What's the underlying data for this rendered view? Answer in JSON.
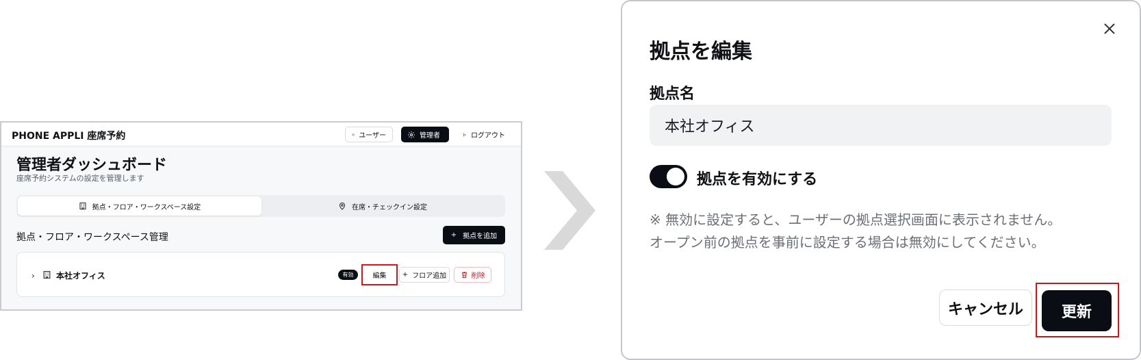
{
  "dashboard": {
    "app_title": "PHONE APPLI 座席予約",
    "header": {
      "user_label": "ユーザー",
      "admin_label": "管理者",
      "logout_label": "ログアウト"
    },
    "title": "管理者ダッシュボード",
    "subtitle": "座席予約システムの設定を管理します",
    "tabs": [
      {
        "label": "拠点・フロア・ワークスペース設定",
        "icon": "building-icon",
        "active": true
      },
      {
        "label": "在席・チェックイン設定",
        "icon": "map-pin-icon",
        "active": false
      }
    ],
    "section_title": "拠点・フロア・ワークスペース管理",
    "add_site_label": "拠点を追加",
    "site": {
      "name": "本社オフィス",
      "status_badge": "有効",
      "edit_label": "編集",
      "add_floor_label": "フロア追加",
      "delete_label": "削除"
    }
  },
  "modal": {
    "title": "拠点を編集",
    "field_label": "拠点名",
    "field_value": "本社オフィス",
    "toggle_on": true,
    "toggle_label": "拠点を有効にする",
    "note_line1": "※ 無効に設定すると、ユーザーの拠点選択画面に表示されません。",
    "note_line2": "オープン前の拠点を事前に設定する場合は無効にしてください。",
    "cancel_label": "キャンセル",
    "update_label": "更新"
  },
  "colors": {
    "primary": "#0b0d14",
    "highlight": "#d3121c",
    "arrow": "#d9d9d9"
  }
}
